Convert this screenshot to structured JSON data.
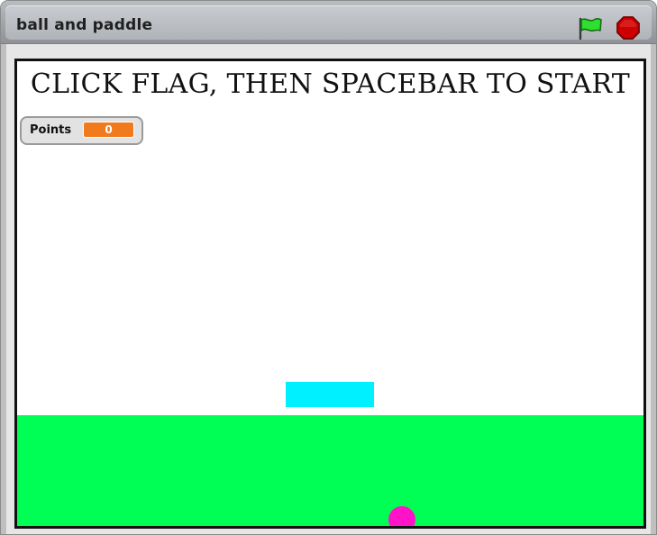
{
  "header": {
    "project_title": "ball and paddle",
    "flag_icon": "green-flag-icon",
    "stop_icon": "stop-sign-icon"
  },
  "stage": {
    "instruction_text": "CLICK FLAG, THEN SPACEBAR TO START",
    "variable_monitor": {
      "label": "Points",
      "value": "0"
    }
  },
  "sprites": {
    "paddle": "paddle",
    "ground": "ground",
    "ball": "ball"
  },
  "colors": {
    "paddle": "#00f0ff",
    "ground": "#00ff55",
    "ball": "#ff12c8",
    "monitor_value": "#f07a1c",
    "flag_green": "#2de02d",
    "stop_red": "#cc0000"
  }
}
